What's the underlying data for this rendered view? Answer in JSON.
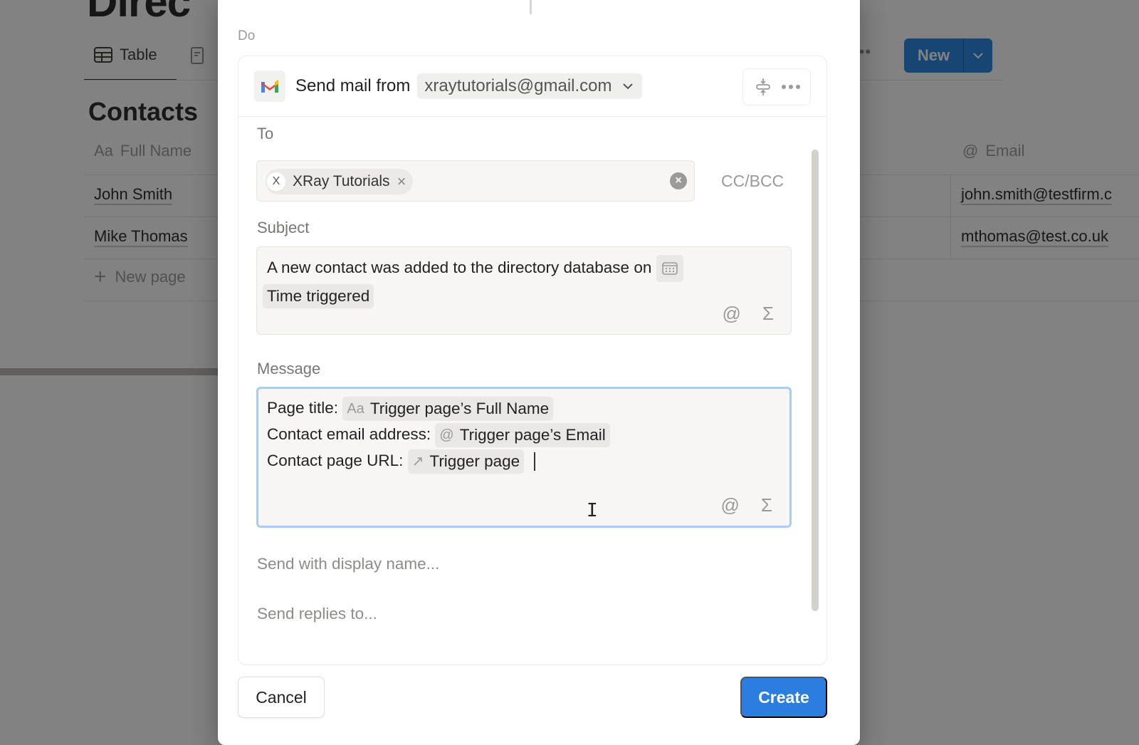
{
  "background": {
    "page_title": "Direc",
    "view_tab": {
      "label": "Table",
      "icon": "table-icon"
    },
    "section_title": "Contacts",
    "columns": [
      {
        "label": "Full Name",
        "icon": "Aa"
      },
      {
        "label": "Email",
        "icon": "@"
      }
    ],
    "rows": [
      {
        "name": "John Smith",
        "email": "john.smith@testfirm.c"
      },
      {
        "name": "Mike Thomas",
        "email": "mthomas@test.co.uk"
      }
    ],
    "new_page_label": "New page",
    "more_label": "•••",
    "new_button": {
      "label": "New",
      "caret": "⌄"
    }
  },
  "modal": {
    "section_label": "Do",
    "action": {
      "icon": "gmail-icon",
      "label": "Send mail from",
      "from_account": "xraytutorials@gmail.com"
    },
    "to": {
      "label": "To",
      "recipients": [
        {
          "initial": "X",
          "name": "XRay Tutorials"
        }
      ],
      "cc_bcc_label": "CC/BCC"
    },
    "subject": {
      "label": "Subject",
      "text": "A new contact was added to the directory database on",
      "token": "Time triggered"
    },
    "message": {
      "label": "Message",
      "lines": [
        {
          "prefix": "Page title:",
          "token_icon": "Aa",
          "token": "Trigger page’s Full Name"
        },
        {
          "prefix": "Contact email address:",
          "token_icon": "@",
          "token": "Trigger page’s Email"
        },
        {
          "prefix": "Contact page URL:",
          "token_icon": "↗",
          "token": "Trigger page"
        }
      ]
    },
    "tool_icons": {
      "mention": "@",
      "formula": "Σ"
    },
    "display_name_placeholder": "Send with display name...",
    "reply_to_placeholder": "Send replies to...",
    "cancel_label": "Cancel",
    "create_label": "Create"
  },
  "colors": {
    "accent": "#2b7de0",
    "focus_ring": "#a8cdf1",
    "field_bg": "#f7f6f4"
  }
}
